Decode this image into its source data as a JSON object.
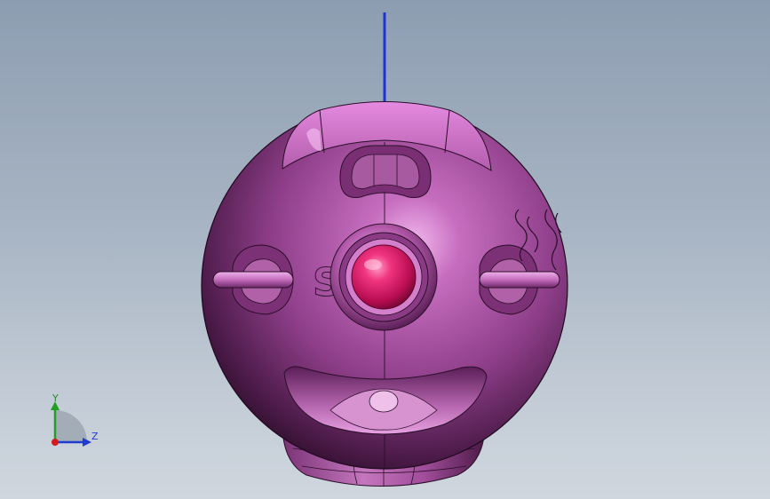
{
  "viewport": {
    "background_top": "#8d9db1",
    "background_bottom": "#cfd6de"
  },
  "model": {
    "body_color": "#a24f9c",
    "body_highlight": "#e59be0",
    "eye_color": "#e0196a",
    "embossed_text": "SPOT",
    "edge_color": "#2a0f28",
    "axis_color": "#2233cc"
  },
  "triad": {
    "y_label": "Y",
    "z_label": "Z",
    "x_color": "#d41a1a",
    "y_color": "#1fa31f",
    "z_color": "#1f3bd1"
  }
}
